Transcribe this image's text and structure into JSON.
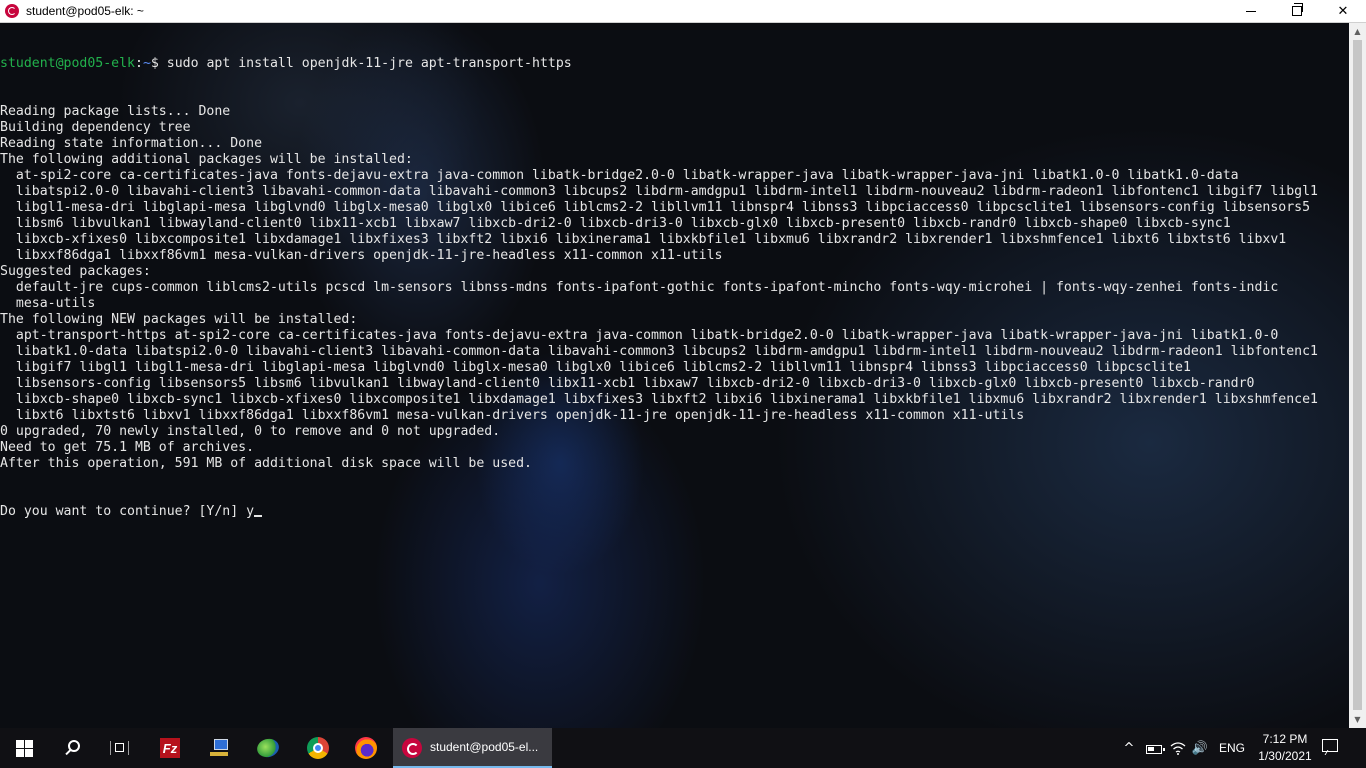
{
  "window": {
    "title": "student@pod05-elk: ~",
    "controls": {
      "minimize": "minimize",
      "maximize": "restore",
      "close": "✕"
    }
  },
  "terminal": {
    "prompt_user": "student@pod05-elk",
    "prompt_sep": ":",
    "prompt_path": "~",
    "prompt_symbol": "$ ",
    "command": "sudo apt install openjdk-11-jre apt-transport-https",
    "output": [
      "Reading package lists... Done",
      "Building dependency tree",
      "Reading state information... Done",
      "The following additional packages will be installed:",
      "  at-spi2-core ca-certificates-java fonts-dejavu-extra java-common libatk-bridge2.0-0 libatk-wrapper-java libatk-wrapper-java-jni libatk1.0-0 libatk1.0-data",
      "  libatspi2.0-0 libavahi-client3 libavahi-common-data libavahi-common3 libcups2 libdrm-amdgpu1 libdrm-intel1 libdrm-nouveau2 libdrm-radeon1 libfontenc1 libgif7 libgl1",
      "  libgl1-mesa-dri libglapi-mesa libglvnd0 libglx-mesa0 libglx0 libice6 liblcms2-2 libllvm11 libnspr4 libnss3 libpciaccess0 libpcsclite1 libsensors-config libsensors5",
      "  libsm6 libvulkan1 libwayland-client0 libx11-xcb1 libxaw7 libxcb-dri2-0 libxcb-dri3-0 libxcb-glx0 libxcb-present0 libxcb-randr0 libxcb-shape0 libxcb-sync1",
      "  libxcb-xfixes0 libxcomposite1 libxdamage1 libxfixes3 libxft2 libxi6 libxinerama1 libxkbfile1 libxmu6 libxrandr2 libxrender1 libxshmfence1 libxt6 libxtst6 libxv1",
      "  libxxf86dga1 libxxf86vm1 mesa-vulkan-drivers openjdk-11-jre-headless x11-common x11-utils",
      "Suggested packages:",
      "  default-jre cups-common liblcms2-utils pcscd lm-sensors libnss-mdns fonts-ipafont-gothic fonts-ipafont-mincho fonts-wqy-microhei | fonts-wqy-zenhei fonts-indic",
      "  mesa-utils",
      "The following NEW packages will be installed:",
      "  apt-transport-https at-spi2-core ca-certificates-java fonts-dejavu-extra java-common libatk-bridge2.0-0 libatk-wrapper-java libatk-wrapper-java-jni libatk1.0-0",
      "  libatk1.0-data libatspi2.0-0 libavahi-client3 libavahi-common-data libavahi-common3 libcups2 libdrm-amdgpu1 libdrm-intel1 libdrm-nouveau2 libdrm-radeon1 libfontenc1",
      "  libgif7 libgl1 libgl1-mesa-dri libglapi-mesa libglvnd0 libglx-mesa0 libglx0 libice6 liblcms2-2 libllvm11 libnspr4 libnss3 libpciaccess0 libpcsclite1",
      "  libsensors-config libsensors5 libsm6 libvulkan1 libwayland-client0 libx11-xcb1 libxaw7 libxcb-dri2-0 libxcb-dri3-0 libxcb-glx0 libxcb-present0 libxcb-randr0",
      "  libxcb-shape0 libxcb-sync1 libxcb-xfixes0 libxcomposite1 libxdamage1 libxfixes3 libxft2 libxi6 libxinerama1 libxkbfile1 libxmu6 libxrandr2 libxrender1 libxshmfence1",
      "  libxt6 libxtst6 libxv1 libxxf86dga1 libxxf86vm1 mesa-vulkan-drivers openjdk-11-jre openjdk-11-jre-headless x11-common x11-utils",
      "0 upgraded, 70 newly installed, 0 to remove and 0 not upgraded.",
      "Need to get 75.1 MB of archives.",
      "After this operation, 591 MB of additional disk space will be used."
    ],
    "input_prompt": "Do you want to continue? [Y/n] ",
    "input_value": "y"
  },
  "taskbar": {
    "icons": [
      "windows-start-icon",
      "search-icon",
      "task-view-icon",
      "filezilla-icon",
      "network-connections-icon",
      "globe-app-icon",
      "chrome-icon",
      "firefox-icon"
    ],
    "fz_letter": "Fz",
    "active_window_label": "student@pod05-el...",
    "tray": {
      "chevron": "^",
      "volume": "🔊",
      "language": "ENG",
      "time": "7:12 PM",
      "date": "1/30/2021"
    }
  },
  "colors": {
    "prompt_user": "#22b14c",
    "prompt_path": "#5b8df5",
    "debian_red": "#c7053d"
  }
}
